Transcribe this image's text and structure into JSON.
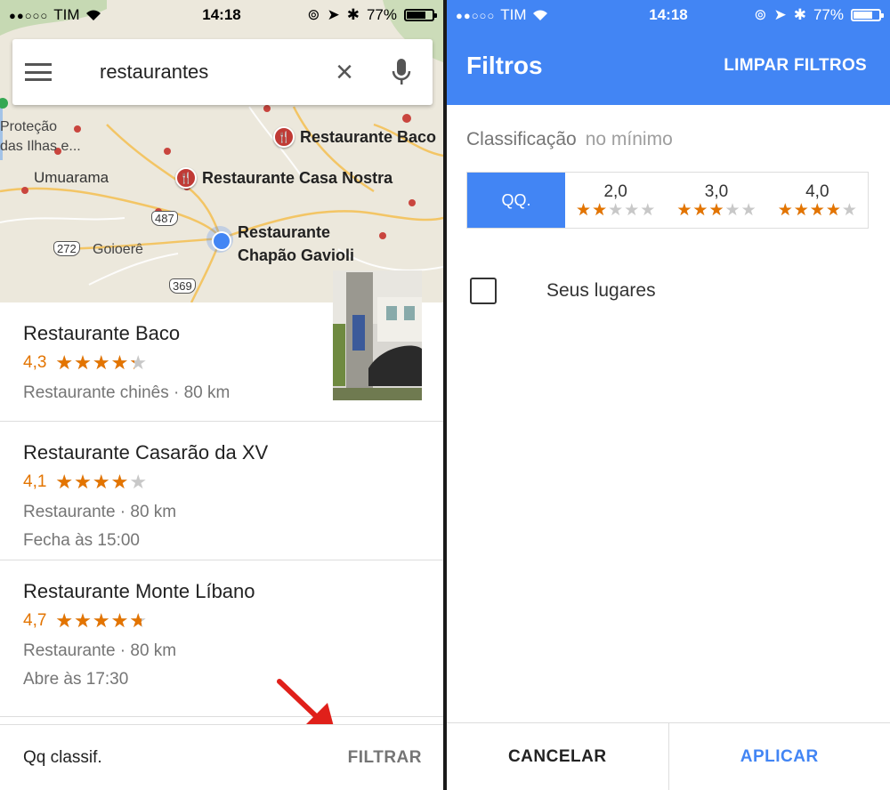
{
  "colors": {
    "accent": "#4285f4",
    "rating": "#e37400",
    "star_off": "#c8c8c8",
    "pin": "#c03a35"
  },
  "left": {
    "status": {
      "carrier": "TIM",
      "signal": "●●○○○",
      "time": "14:18",
      "battery": "77%",
      "battery_level": 0.77
    },
    "search": {
      "query": "restaurantes",
      "menu_icon": "menu-icon",
      "clear_icon": "close-icon",
      "mic_icon": "mic-icon"
    },
    "map": {
      "places": [
        {
          "name": "Restaurante Baco"
        },
        {
          "name": "Restaurante Casa Nostra"
        },
        {
          "name": "Restaurante\nChapão Gavioli"
        }
      ],
      "towns": [
        "Proteção",
        "das Ilhas e...",
        "Umuarama",
        "Goioerê"
      ],
      "roads": [
        "487",
        "272",
        "369"
      ]
    },
    "results": [
      {
        "title": "Restaurante Baco",
        "score": "4,3",
        "stars": 4.3,
        "lines": [
          "Restaurante chinês · 80 km"
        ]
      },
      {
        "title": "Restaurante Casarão da XV",
        "score": "4,1",
        "stars": 4.1,
        "lines": [
          "Restaurante · 80 km",
          "Fecha às 15:00"
        ]
      },
      {
        "title": "Restaurante Monte Líbano",
        "score": "4,7",
        "stars": 4.7,
        "lines": [
          "Restaurante · 80 km",
          "Abre às 17:30"
        ]
      }
    ],
    "bottom": {
      "classif": "Qq classif.",
      "filter_button": "FILTRAR"
    }
  },
  "right": {
    "status": {
      "carrier": "TIM",
      "signal": "●●○○○",
      "time": "14:18",
      "battery": "77%",
      "battery_level": 0.77
    },
    "appbar": {
      "title": "Filtros",
      "clear_filters": "LIMPAR FILTROS"
    },
    "rating": {
      "label": "Classificação",
      "qualifier": "no mínimo",
      "options": [
        {
          "label": "QQ.",
          "stars": null,
          "selected": true
        },
        {
          "label": "2,0",
          "stars": 2,
          "selected": false
        },
        {
          "label": "3,0",
          "stars": 3,
          "selected": false
        },
        {
          "label": "4,0",
          "stars": 4,
          "selected": false
        }
      ]
    },
    "your_places": {
      "label": "Seus lugares",
      "checked": false
    },
    "actions": {
      "cancel": "CANCELAR",
      "apply": "APLICAR"
    }
  }
}
